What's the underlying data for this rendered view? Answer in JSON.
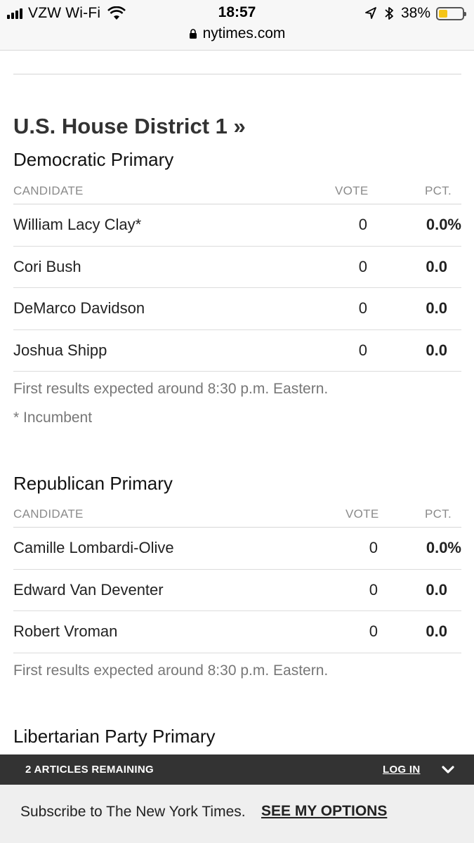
{
  "status": {
    "carrier": "VZW Wi-Fi",
    "time": "18:57",
    "battery_pct": "38%",
    "battery_level": 0.38,
    "battery_color": "#f5c518",
    "url": "nytimes.com"
  },
  "district": {
    "title": "U.S. House District 1 »"
  },
  "democratic": {
    "title": "Democratic Primary",
    "headers": {
      "candidate": "CANDIDATE",
      "vote": "VOTE",
      "pct": "PCT."
    },
    "rows": [
      {
        "name": "William Lacy Clay*",
        "vote": "0",
        "pct": "0.0%"
      },
      {
        "name": "Cori Bush",
        "vote": "0",
        "pct": "0.0"
      },
      {
        "name": "DeMarco Davidson",
        "vote": "0",
        "pct": "0.0"
      },
      {
        "name": "Joshua Shipp",
        "vote": "0",
        "pct": "0.0"
      }
    ],
    "note": "First results expected around 8:30 p.m. Eastern.",
    "footnote": "* Incumbent"
  },
  "republican": {
    "title": "Republican Primary",
    "headers": {
      "candidate": "CANDIDATE",
      "vote": "VOTE",
      "pct": "PCT."
    },
    "rows": [
      {
        "name": "Camille Lombardi-Olive",
        "vote": "0",
        "pct": "0.0%"
      },
      {
        "name": "Edward Van Deventer",
        "vote": "0",
        "pct": "0.0"
      },
      {
        "name": "Robert Vroman",
        "vote": "0",
        "pct": "0.0"
      }
    ],
    "note": "First results expected around 8:30 p.m. Eastern."
  },
  "libertarian": {
    "title": "Libertarian Party Primary"
  },
  "paywall": {
    "articles_remaining": "2 ARTICLES REMAINING",
    "login": "LOG IN",
    "subscribe_text": "Subscribe to The New York Times.",
    "options_link": "SEE MY OPTIONS"
  }
}
